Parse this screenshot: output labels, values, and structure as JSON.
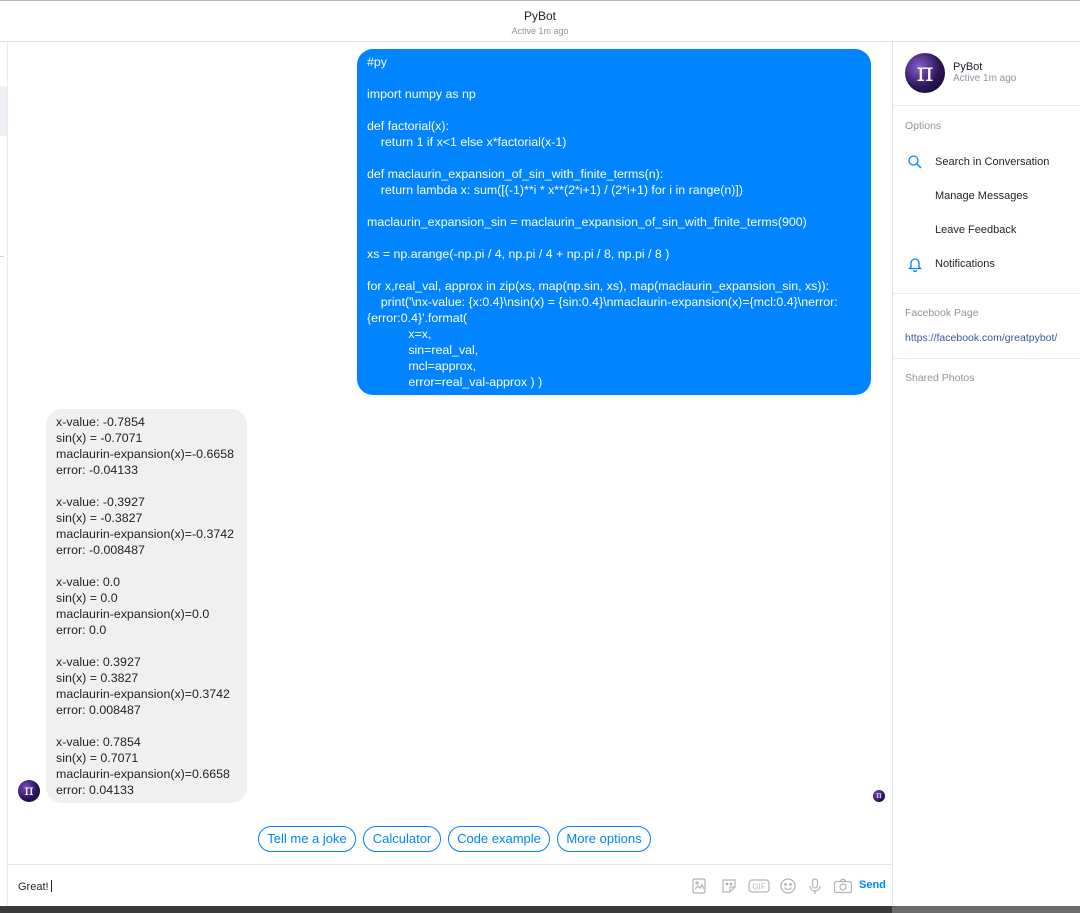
{
  "header": {
    "title": "PyBot",
    "status": "Active 1m ago"
  },
  "messages": {
    "outgoing_code": "#py\n\nimport numpy as np\n\ndef factorial(x):\n    return 1 if x<1 else x*factorial(x-1)\n\ndef maclaurin_expansion_of_sin_with_finite_terms(n):\n    return lambda x: sum([(-1)**i * x**(2*i+1) / (2*i+1) for i in range(n)])\n\nmaclaurin_expansion_sin = maclaurin_expansion_of_sin_with_finite_terms(900)\n\nxs = np.arange(-np.pi / 4, np.pi / 4 + np.pi / 8, np.pi / 8 )\n\nfor x,real_val, approx in zip(xs, map(np.sin, xs), map(maclaurin_expansion_sin, xs)):\n    print('\\nx-value: {x:0.4}\\nsin(x) = {sin:0.4}\\nmaclaurin-expansion(x)={mcl:0.4}\\nerror:\n{error:0.4}'.format(\n            x=x,\n            sin=real_val,\n            mcl=approx,\n            error=real_val-approx ) )",
    "incoming_output": "x-value: -0.7854\nsin(x) = -0.7071\nmaclaurin-expansion(x)=-0.6658\nerror: -0.04133\n\nx-value: -0.3927\nsin(x) = -0.3827\nmaclaurin-expansion(x)=-0.3742\nerror: -0.008487\n\nx-value: 0.0\nsin(x) = 0.0\nmaclaurin-expansion(x)=0.0\nerror: 0.0\n\nx-value: 0.3927\nsin(x) = 0.3827\nmaclaurin-expansion(x)=0.3742\nerror: 0.008487\n\nx-value: 0.7854\nsin(x) = 0.7071\nmaclaurin-expansion(x)=0.6658\nerror: 0.04133",
    "bot_avatar_glyph": "π"
  },
  "quick_replies": [
    "Tell me a joke",
    "Calculator",
    "Code example",
    "More options"
  ],
  "composer": {
    "value": "Great!",
    "send_label": "Send",
    "icons": [
      "photo-icon",
      "sticker-icon",
      "gif-icon",
      "emoji-icon",
      "microphone-icon",
      "camera-icon"
    ]
  },
  "sidebar": {
    "name": "PyBot",
    "status": "Active 1m ago",
    "options_label": "Options",
    "options": [
      {
        "label": "Search in Conversation",
        "icon": "search-icon"
      },
      {
        "label": "Manage Messages",
        "icon": ""
      },
      {
        "label": "Leave Feedback",
        "icon": ""
      },
      {
        "label": "Notifications",
        "icon": "bell-icon"
      }
    ],
    "facebook_page_label": "Facebook Page",
    "facebook_page_url": "https://facebook.com/greatpybot/",
    "shared_photos_label": "Shared Photos"
  },
  "colors": {
    "accent": "#0084ff",
    "incoming_bubble": "#f1f0f0",
    "muted_text": "#90949c",
    "link": "#365899"
  }
}
